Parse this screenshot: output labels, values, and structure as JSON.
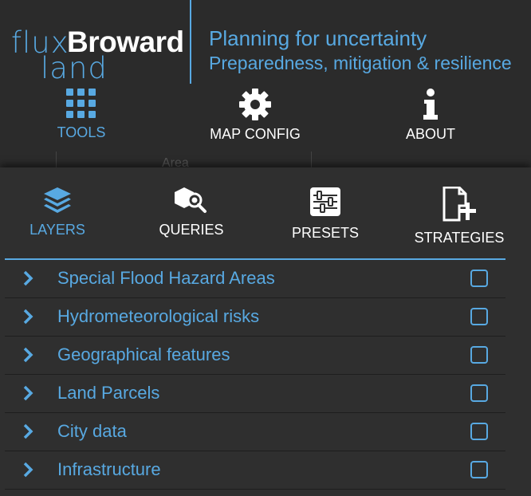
{
  "branding": {
    "logo_flux": "flux",
    "logo_broward": "Broward",
    "logo_land": "land",
    "tagline_main": "Planning for uncertainty",
    "tagline_sub": "Preparedness, mitigation & resilience"
  },
  "topnav": {
    "items": [
      {
        "label": "TOOLS",
        "icon": "grid-icon",
        "active": true
      },
      {
        "label": "MAP CONFIG",
        "icon": "gear-icon",
        "active": false
      },
      {
        "label": "ABOUT",
        "icon": "info-icon",
        "active": false
      }
    ]
  },
  "underlay": {
    "ghost_text": "Area"
  },
  "tabs": {
    "items": [
      {
        "label": "LAYERS",
        "icon": "layers-icon",
        "active": true
      },
      {
        "label": "QUERIES",
        "icon": "query-search-icon",
        "active": false
      },
      {
        "label": "PRESETS",
        "icon": "sliders-icon",
        "active": false
      },
      {
        "label": "STRATEGIES",
        "icon": "add-document-icon",
        "active": false
      }
    ]
  },
  "layers": {
    "items": [
      {
        "name": "Special Flood Hazard Areas",
        "checked": false
      },
      {
        "name": "Hydrometeorological risks",
        "checked": false
      },
      {
        "name": "Geographical features",
        "checked": false
      },
      {
        "name": "Land Parcels",
        "checked": false
      },
      {
        "name": "City data",
        "checked": false
      },
      {
        "name": "Infrastructure",
        "checked": false
      }
    ]
  },
  "colors": {
    "accent": "#58a9e2",
    "background": "#2e2e2e",
    "header_background": "#2b2b2b",
    "text_inactive": "#ffffff"
  }
}
